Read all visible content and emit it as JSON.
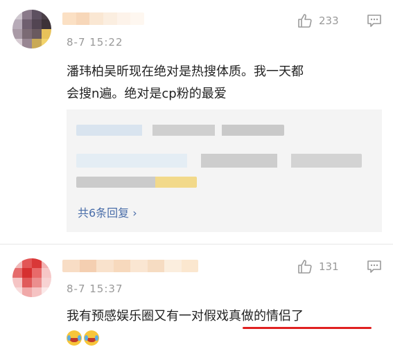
{
  "comments": [
    {
      "time": "8-7 15:22",
      "like_count": "233",
      "text_line1": "潘玮柏吴昕现在绝对是热搜体质。我一天都",
      "text_line2": "会搜n遍。绝对是cp粉的最爱",
      "replies_more": "共6条回复 ›"
    },
    {
      "time": "8-7 15:37",
      "like_count": "131",
      "text_part1": "我有预感娱乐圈又有一对",
      "text_part2": "假戏真做的情侣了"
    }
  ],
  "icons": {
    "like": "thumbs-up-icon",
    "reply": "comment-bubble-icon",
    "emoji": "laughing-crying-emoji"
  },
  "colors": {
    "link": "#4a6ea9",
    "muted": "#999999",
    "underline": "#e02020"
  }
}
